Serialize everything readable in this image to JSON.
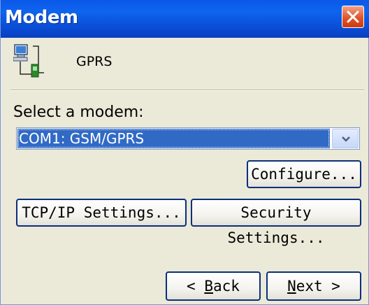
{
  "window": {
    "title": "Modem"
  },
  "header": {
    "label": "GPRS",
    "icon": "network-connection-icon"
  },
  "form": {
    "select_label": "Select a modem:",
    "modem_value": "COM1: GSM/GPRS"
  },
  "buttons": {
    "configure": "Configure...",
    "tcpip": "TCP/IP Settings...",
    "security": "Security Settings...",
    "back_prefix": "< ",
    "back_accel": "B",
    "back_rest": "ack",
    "next_accel": "N",
    "next_rest": "ext >"
  },
  "colors": {
    "titlebar": "#0a58e8",
    "selection": "#316ac5",
    "close_button": "#e0552a"
  }
}
